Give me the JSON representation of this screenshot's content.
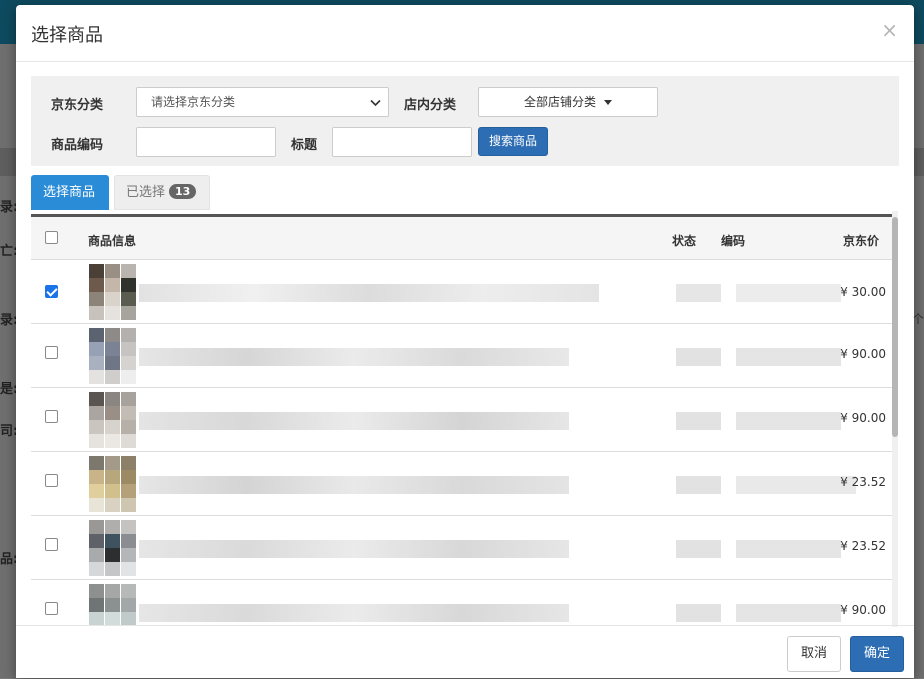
{
  "modal": {
    "title": "选择商品",
    "close": "×"
  },
  "filters": {
    "jd_category_label": "京东分类",
    "jd_category_value": "请选择京东分类",
    "store_category_label": "店内分类",
    "store_category_value": "全部店铺分类",
    "code_label": "商品编码",
    "code_value": "",
    "title_label": "标题",
    "title_value": "",
    "search_button": "搜索商品"
  },
  "tabs": {
    "select": "选择商品",
    "selected": "已选择",
    "selected_count": "13"
  },
  "table": {
    "headers": {
      "info": "商品信息",
      "status": "状态",
      "code": "编码",
      "price": "京东价"
    },
    "rows": [
      {
        "checked": true,
        "price": "¥ 30.00"
      },
      {
        "checked": false,
        "price": "¥ 90.00"
      },
      {
        "checked": false,
        "price": "¥ 90.00"
      },
      {
        "checked": false,
        "price": "¥ 23.52"
      },
      {
        "checked": false,
        "price": "¥ 23.52"
      },
      {
        "checked": false,
        "price": "¥ 90.00"
      }
    ]
  },
  "footer": {
    "cancel": "取消",
    "confirm": "确定"
  },
  "colors": {
    "primary": "#2d6db3",
    "tab_active": "#2a8bd6",
    "checkbox_checked": "#1a73e8"
  }
}
